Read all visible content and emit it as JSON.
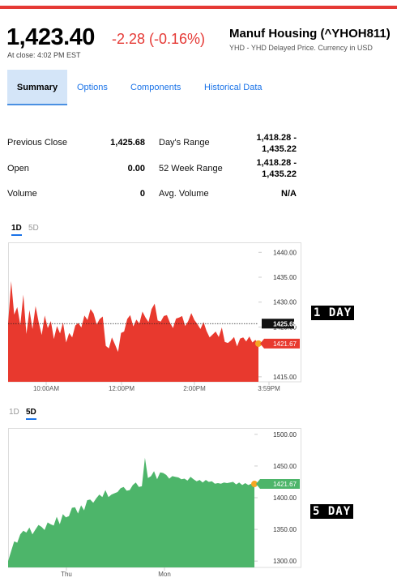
{
  "header": {
    "price": "1,423.40",
    "change": "-2.28 (-0.16%)",
    "close_time": "At close: 4:02 PM EST",
    "index_name": "Manuf Housing (^YHOH811)",
    "index_sub": "YHD - YHD Delayed Price. Currency in USD",
    "change_color": "#e53935"
  },
  "tabs": [
    {
      "label": "Summary"
    },
    {
      "label": "Options"
    },
    {
      "label": "Components"
    },
    {
      "label": "Historical Data"
    }
  ],
  "stats": {
    "previous_close": {
      "label": "Previous Close",
      "value": "1,425.68"
    },
    "open": {
      "label": "Open",
      "value": "0.00"
    },
    "volume": {
      "label": "Volume",
      "value": "0"
    },
    "days_range": {
      "label": "Day's Range",
      "value_line1": "1,418.28 -",
      "value_line2": "1,435.22"
    },
    "week52_range": {
      "label": "52 Week Range",
      "value_line1": "1,418.28 -",
      "value_line2": "1,435.22"
    },
    "avg_volume": {
      "label": "Avg. Volume",
      "value": "N/A"
    }
  },
  "chart1_toggle": {
    "d1": "1D",
    "d5": "5D",
    "selected": "1D"
  },
  "chart2_toggle": {
    "d1": "1D",
    "d5": "5D",
    "selected": "5D"
  },
  "side_labels": {
    "one_day": "1 DAY",
    "five_day": "5 DAY"
  },
  "chart_data": [
    {
      "type": "area",
      "color": "#e8392e",
      "y_ticks": [
        "1440.00",
        "1435.00",
        "1430.00",
        "1425.00",
        "1415.00"
      ],
      "x_ticks": [
        "10:00AM",
        "12:00PM",
        "2:00PM",
        "3:59PM"
      ],
      "ylim": [
        1414,
        1442
      ],
      "previous_close": 1425.68,
      "previous_close_label": "1425.68",
      "last_value": 1421.67,
      "last_value_label": "1421.67",
      "values": [
        1425.7,
        1434.2,
        1427.5,
        1429.0,
        1425.4,
        1431.5,
        1423.6,
        1428.4,
        1424.6,
        1429.2,
        1426.0,
        1423.4,
        1427.3,
        1424.8,
        1426.2,
        1422.6,
        1425.2,
        1423.7,
        1425.9,
        1421.9,
        1423.8,
        1422.9,
        1425.3,
        1425.8,
        1424.9,
        1427.3,
        1426.4,
        1428.6,
        1427.7,
        1425.5,
        1426.6,
        1427.1,
        1421.2,
        1420.7,
        1422.9,
        1421.5,
        1420.0,
        1423.8,
        1424.1,
        1426.6,
        1427.4,
        1425.1,
        1426.5,
        1425.7,
        1428.1,
        1426.9,
        1426.0,
        1428.6,
        1429.7,
        1426.3,
        1426.1,
        1427.2,
        1427.4,
        1425.9,
        1424.8,
        1426.7,
        1426.9,
        1427.2,
        1425.2,
        1426.2,
        1427.8,
        1426.4,
        1425.6,
        1424.6,
        1426.0,
        1424.2,
        1422.9,
        1423.5,
        1424.1,
        1423.0,
        1424.9,
        1422.0,
        1421.8,
        1422.3,
        1423.0,
        1421.1,
        1422.7,
        1422.9,
        1422.1,
        1423.1,
        1421.9,
        1422.4,
        1421.7
      ]
    },
    {
      "type": "area",
      "color": "#4db56a",
      "y_ticks": [
        "1500.00",
        "1450.00",
        "1400.00",
        "1350.00",
        "1300.00"
      ],
      "x_ticks": [
        "Thu",
        "Mon"
      ],
      "ylim": [
        1290,
        1510
      ],
      "last_value": 1421.67,
      "last_value_label": "1421.67",
      "values": [
        1300,
        1316,
        1331,
        1329,
        1342,
        1348,
        1345,
        1353,
        1342,
        1350,
        1357,
        1354,
        1349,
        1361,
        1358,
        1356,
        1370,
        1358,
        1374,
        1369,
        1371,
        1384,
        1385,
        1375,
        1388,
        1380,
        1396,
        1397,
        1392,
        1399,
        1405,
        1401,
        1412,
        1401,
        1405,
        1407,
        1409,
        1415,
        1417,
        1411,
        1412,
        1420,
        1424,
        1417,
        1418,
        1463,
        1431,
        1434,
        1442,
        1429,
        1440,
        1439,
        1436,
        1430,
        1434,
        1433,
        1432,
        1429,
        1430,
        1427,
        1433,
        1429,
        1426,
        1428,
        1424,
        1428,
        1425,
        1426,
        1422,
        1423,
        1422,
        1424,
        1423,
        1424,
        1425,
        1421,
        1424,
        1420,
        1423,
        1420,
        1422,
        1422
      ]
    }
  ]
}
